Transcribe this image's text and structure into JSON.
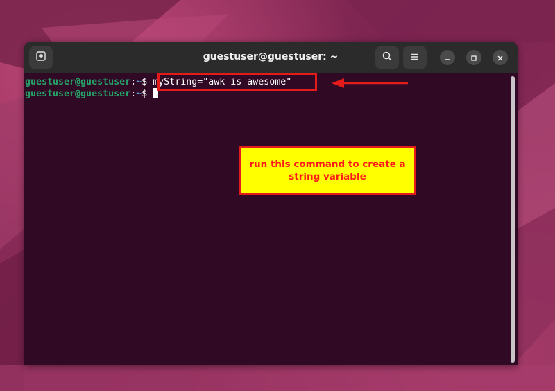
{
  "window": {
    "title": "guestuser@guestuser: ~"
  },
  "terminal": {
    "lines": [
      {
        "user_host": "guestuser@guestuser",
        "separator": ":",
        "path": "~",
        "prompt_symbol": "$",
        "command": "myString=\"awk is awesome\""
      },
      {
        "user_host": "guestuser@guestuser",
        "separator": ":",
        "path": "~",
        "prompt_symbol": "$",
        "command": ""
      }
    ]
  },
  "annotation": {
    "callout_text": "run this command to create a string variable"
  },
  "icons": {
    "new_tab": "new-tab-icon",
    "search": "search-icon",
    "menu": "hamburger-menu-icon",
    "minimize": "minimize-icon",
    "maximize": "maximize-icon",
    "close": "close-icon"
  },
  "colors": {
    "terminal_bg": "#300a24",
    "titlebar_bg": "#2b2b2b",
    "user_host": "#26a269",
    "path": "#5c9bd6",
    "annotation_red": "#e31b1b",
    "callout_bg": "#ffff00"
  }
}
